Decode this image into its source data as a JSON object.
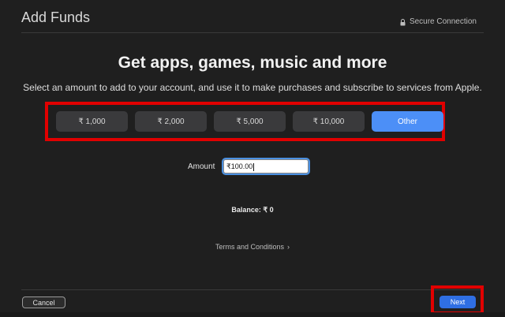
{
  "header": {
    "title": "Add Funds",
    "secure_label": "Secure Connection",
    "secure_icon": "lock-icon"
  },
  "main": {
    "headline": "Get apps, games, music and more",
    "subline": "Select an amount to add to your account, and use it to make purchases and subscribe to services from Apple.",
    "amounts": [
      {
        "label": "₹ 1,000"
      },
      {
        "label": "₹ 2,000"
      },
      {
        "label": "₹ 5,000"
      },
      {
        "label": "₹ 10,000"
      },
      {
        "label": "Other",
        "selected": true
      }
    ],
    "amount_label": "Amount",
    "amount_value": "₹100.00",
    "balance": "Balance: ₹ 0",
    "terms": "Terms and Conditions",
    "terms_chevron": "›"
  },
  "footer": {
    "cancel_label": "Cancel",
    "next_label": "Next"
  },
  "colors": {
    "accent": "#4c8ff7",
    "next": "#2f6fe4",
    "highlight": "#e10000",
    "background": "#1f1f1f"
  }
}
